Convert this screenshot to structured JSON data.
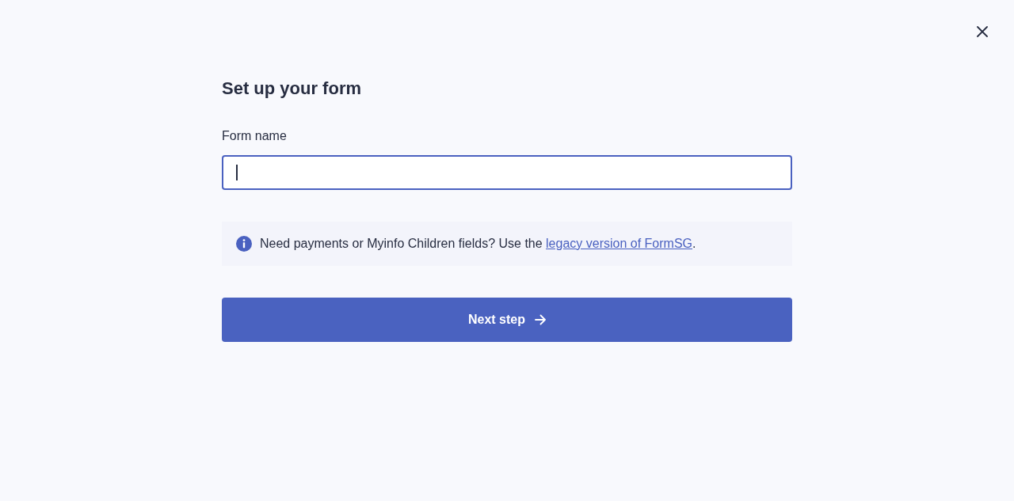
{
  "title": "Set up your form",
  "form_name_field": {
    "label": "Form name",
    "focused": true
  },
  "notice": {
    "parts": [
      {
        "kind": "text",
        "text": "Need payments or Myinfo Children fields? Use the "
      },
      {
        "kind": "link",
        "text": "legacy version of FormSG"
      },
      {
        "kind": "text",
        "text": "."
      }
    ]
  },
  "next_button": {
    "label": "Next step"
  }
}
